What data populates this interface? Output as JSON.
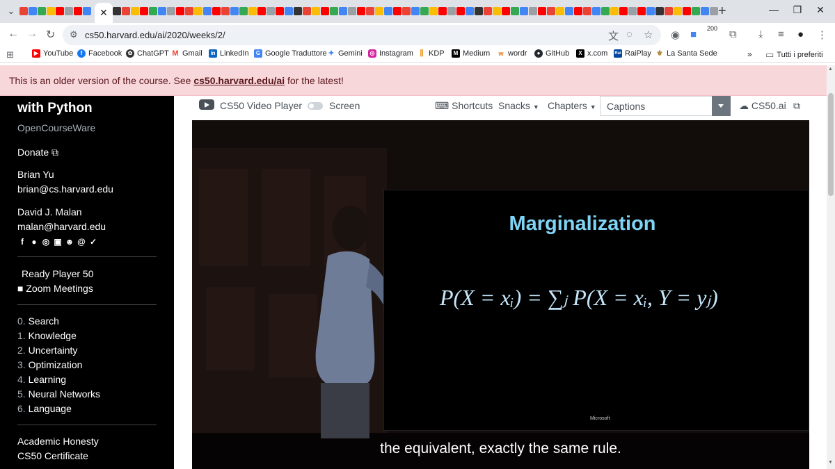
{
  "browser": {
    "url": "cs50.harvard.edu/ai/2020/weeks/2/",
    "extension_badge": "200",
    "bookmarks": [
      "YouTube",
      "Facebook",
      "ChatGPT",
      "Gmail",
      "LinkedIn",
      "Google Traduttore",
      "Gemini",
      "Instagram",
      "KDP",
      "Medium",
      "wordr",
      "GitHub",
      "x.com",
      "RaiPlay",
      "La Santa Sede"
    ],
    "bookmarks_overflow": "»",
    "all_bookmarks_label": "Tutti i preferiti",
    "tab_favicon_colors": [
      "#ea4335",
      "#4285f4",
      "#34a853",
      "#fbbc05",
      "#ff0000",
      "#9aa0a6",
      "#ff0000",
      "#4285f4",
      "#333333",
      "#ea4335",
      "#fbbc05",
      "#ff0000",
      "#34a853",
      "#4285f4",
      "#9aa0a6",
      "#ff0000",
      "#ea4335",
      "#fbbc05",
      "#4285f4",
      "#ff0000"
    ]
  },
  "banner": {
    "prefix": "This is an older version of the course. See ",
    "link": "cs50.harvard.edu/ai",
    "suffix": " for the latest!"
  },
  "sidebar": {
    "course_title": "with Python",
    "subtitle": "OpenCourseWare",
    "donate": "Donate",
    "instructors": [
      {
        "name": "Brian Yu",
        "email": "brian@cs.harvard.edu"
      },
      {
        "name": "David J. Malan",
        "email": "malan@harvard.edu"
      }
    ],
    "social_icons": [
      "facebook-icon",
      "github-icon",
      "instagram-icon",
      "linkedin-icon",
      "reddit-icon",
      "threads-icon",
      "twitter-icon"
    ],
    "extras": [
      "Ready Player 50",
      "Zoom Meetings"
    ],
    "lectures": [
      {
        "num": "0.",
        "title": "Search"
      },
      {
        "num": "1.",
        "title": "Knowledge"
      },
      {
        "num": "2.",
        "title": "Uncertainty"
      },
      {
        "num": "3.",
        "title": "Optimization"
      },
      {
        "num": "4.",
        "title": "Learning"
      },
      {
        "num": "5.",
        "title": "Neural Networks"
      },
      {
        "num": "6.",
        "title": "Language"
      }
    ],
    "footer_links": [
      "Academic Honesty",
      "CS50 Certificate"
    ]
  },
  "player": {
    "title": "CS50 Video Player",
    "screen_label": "Screen",
    "shortcuts": "Shortcuts",
    "snacks": "Snacks",
    "chapters": "Chapters",
    "captions_placeholder": "Captions",
    "cs50ai": "CS50.ai"
  },
  "video": {
    "slide_title": "Marginalization",
    "formula": "P(X = xᵢ) = ∑ⱼ P(X = xᵢ, Y = yⱼ)",
    "logo": "Microsoft",
    "subtitle": "the equivalent, exactly the same rule."
  }
}
